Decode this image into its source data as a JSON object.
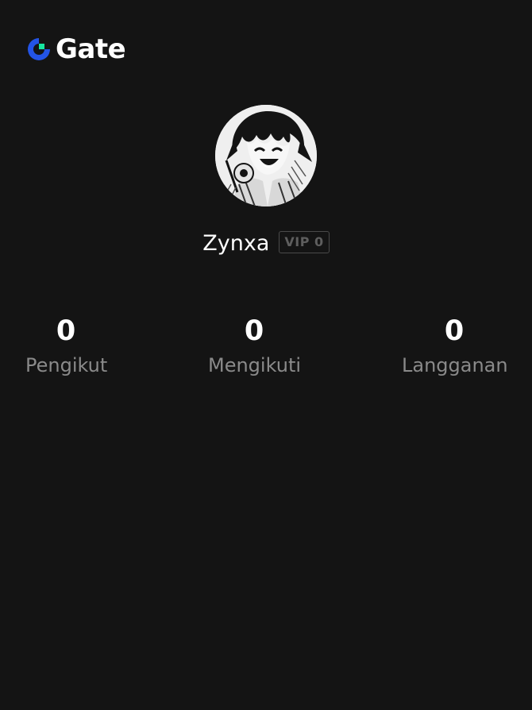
{
  "brand": {
    "name": "Gate",
    "logo_icon": "gate-logo-icon",
    "colors": {
      "blue": "#2354E6",
      "green": "#17E6A1"
    }
  },
  "profile": {
    "avatar_icon": "user-avatar",
    "username": "Zynxa",
    "vip_badge": "VIP 0"
  },
  "stats": [
    {
      "value": "0",
      "label": "Pengikut"
    },
    {
      "value": "0",
      "label": "Mengikuti"
    },
    {
      "value": "0",
      "label": "Langganan"
    }
  ],
  "theme": {
    "background": "#141414",
    "text_primary": "#FFFFFF",
    "text_secondary": "#8A8A8A"
  }
}
